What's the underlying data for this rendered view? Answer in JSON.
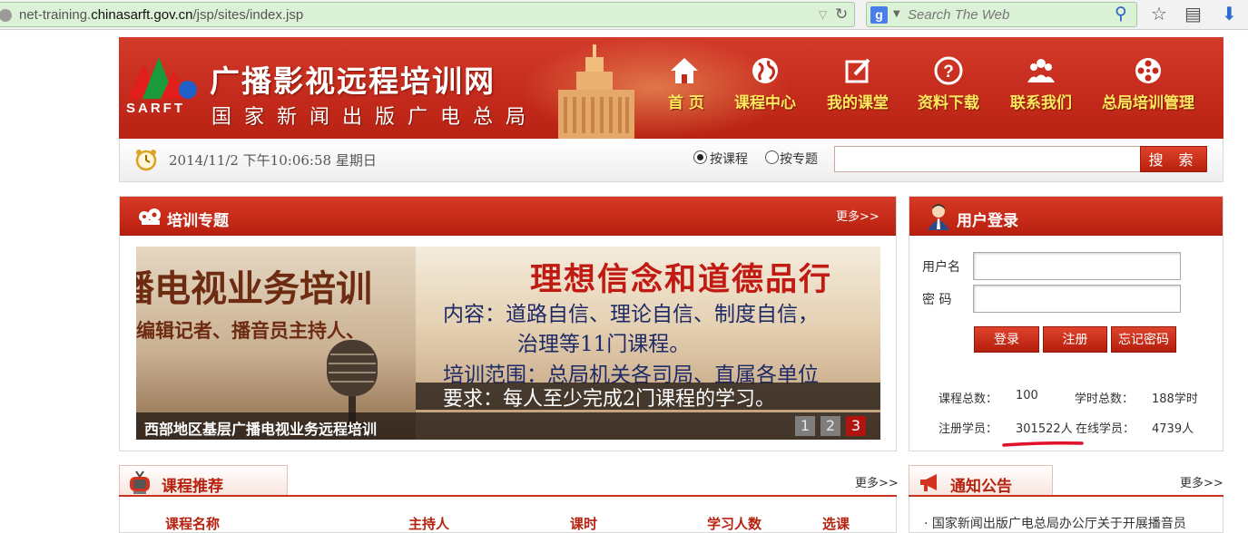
{
  "browser": {
    "url_prefix": "net-training.",
    "url_domain": "chinasarft.gov.cn",
    "url_path": "/jsp/sites/index.jsp",
    "search_engine_letter": "g",
    "search_placeholder": "Search The Web"
  },
  "header": {
    "logo_text": "SARFT",
    "site_title": "广播影视远程培训网",
    "site_subtitle": "国家新闻出版广电总局",
    "nav": [
      {
        "label": "首 页",
        "icon": "home-icon"
      },
      {
        "label": "课程中心",
        "icon": "globe-icon"
      },
      {
        "label": "我的课堂",
        "icon": "edit-icon"
      },
      {
        "label": "资料下载",
        "icon": "help-icon"
      },
      {
        "label": "联系我们",
        "icon": "people-icon"
      },
      {
        "label": "总局培训管理",
        "icon": "film-reel-icon"
      }
    ]
  },
  "toolbar": {
    "datetime": "2014/11/2 下午10:06:58 星期日",
    "radio_course": "按课程",
    "radio_topic": "按专题",
    "search_button": "搜 索"
  },
  "training_topics": {
    "title": "培训专题",
    "more": "更多>>",
    "slide": {
      "left_big": "播电视业务培训",
      "left_mid": "编辑记者、播音员主持人、",
      "right_title": "理想信念和道德品行",
      "right_line1": "内容：道路自信、理论自信、制度自信，",
      "right_line2": "治理等11门课程。",
      "right_line3": "培训范围：总局机关各司局、直属各单位",
      "right_req": "要求：每人至少完成2门课程的学习。",
      "caption": "西部地区基层广播电视业务远程培训"
    },
    "pages": [
      "1",
      "2",
      "3"
    ],
    "active_page": "3"
  },
  "login": {
    "title": "用户登录",
    "username_label": "用户名",
    "password_label": "密 码",
    "login_button": "登录",
    "register_button": "注册",
    "forgot_button": "忘记密码",
    "stats": {
      "courses_label": "课程总数：",
      "courses_value": "100",
      "hours_label": "学时总数：",
      "hours_value": "188学时",
      "registered_label": "注册学员：",
      "registered_value": "301522人",
      "online_label": "在线学员：",
      "online_value": "4739人"
    }
  },
  "course_recommend": {
    "title": "课程推荐",
    "more": "更多>>",
    "columns": [
      "课程名称",
      "主持人",
      "课时",
      "学习人数",
      "选课"
    ]
  },
  "notices": {
    "title": "通知公告",
    "more": "更多>>",
    "first_item": "· 国家新闻出版广电总局办公厅关于开展播音员"
  },
  "colors": {
    "banner_red": "#c42a1b",
    "nav_yellow": "#ffe95c",
    "url_green": "#dcf2d6"
  }
}
